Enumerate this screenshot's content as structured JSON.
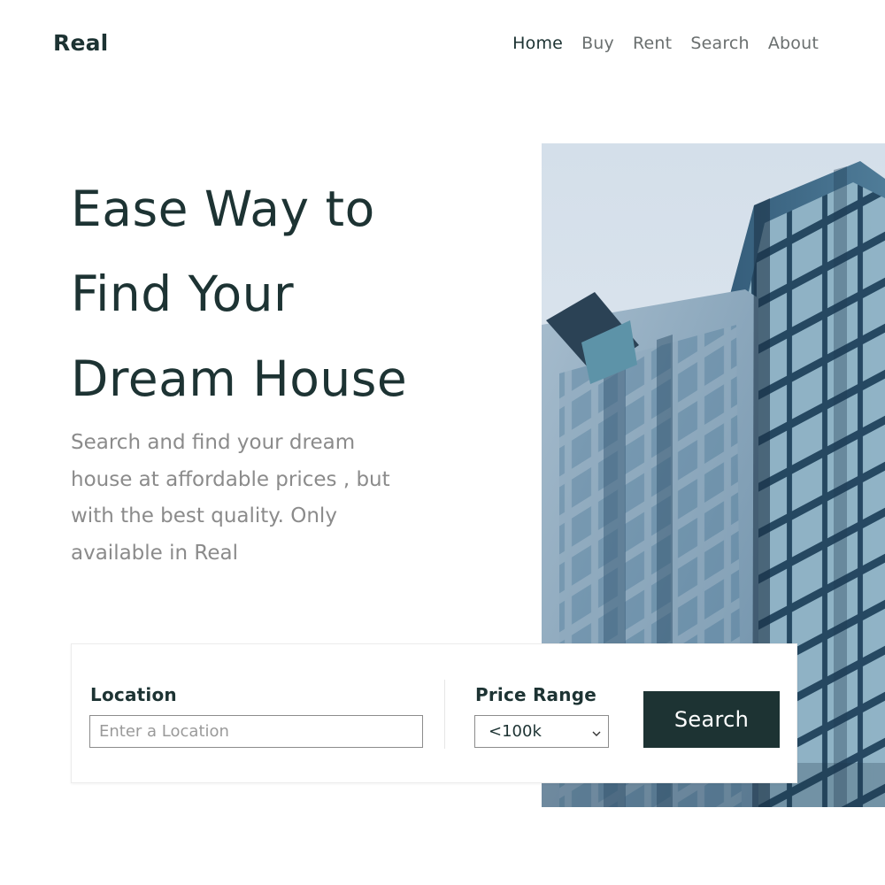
{
  "brand": {
    "name": "Real"
  },
  "nav": {
    "items": [
      {
        "label": "Home",
        "active": true
      },
      {
        "label": "Buy",
        "active": false
      },
      {
        "label": "Rent",
        "active": false
      },
      {
        "label": "Search",
        "active": false
      },
      {
        "label": "About",
        "active": false
      }
    ]
  },
  "hero": {
    "title_lines": [
      "Ease Way to",
      "Find Your",
      "Dream House"
    ],
    "description": "Search and find your dream house at affordable prices , but with the best quality. Only available in Real"
  },
  "search": {
    "location_label": "Location",
    "location_placeholder": "Enter a Location",
    "location_value": "",
    "price_label": "Price Range",
    "price_value": "<100k",
    "button_label": "Search"
  },
  "colors": {
    "primary": "#1d3333",
    "muted_text": "#8b8b8b",
    "nav_inactive": "#6a6f6f",
    "background": "#ffffff"
  },
  "icons": {
    "select_chevron": "chevron-down-icon"
  }
}
